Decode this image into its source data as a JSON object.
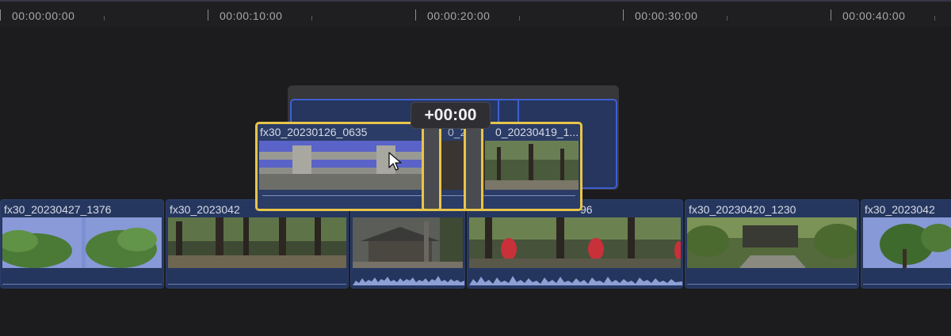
{
  "ruler": {
    "timecodes": [
      "00:00:00:00",
      "00:00:10:00",
      "00:00:20:00",
      "00:00:30:00",
      "00:00:40:00"
    ]
  },
  "offset_indicator": "+00:00",
  "dragged_clip": {
    "name": "fx30_20230126_0635",
    "overlap_name_a": "0_2",
    "overlap_name_b": "0_20230419_1..."
  },
  "primary_clips": [
    {
      "name": "fx30_20230427_1376"
    },
    {
      "name": "fx30_2023042"
    },
    {
      "name": ""
    },
    {
      "name": "96"
    },
    {
      "name": "fx30_20230420_1230"
    },
    {
      "name": "fx30_2023042"
    }
  ],
  "colors": {
    "selection": "#e7c54a",
    "clip": "#26375f",
    "ghost_outline": "#3f5fd0"
  },
  "icons": {
    "cursor": "arrow-pointer-icon"
  }
}
